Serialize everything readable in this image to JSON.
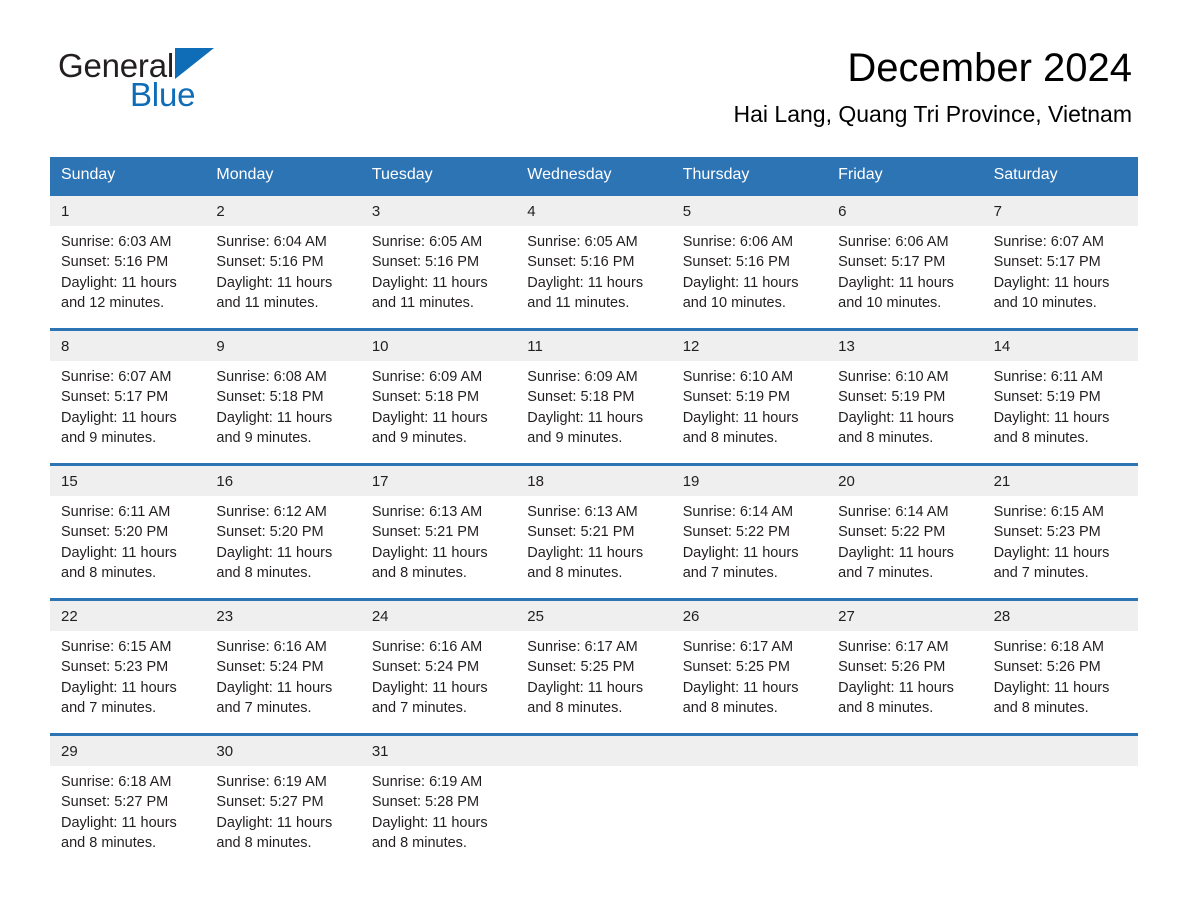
{
  "brand": {
    "name_part1": "General",
    "name_part2": "Blue",
    "accent_color": "#0f6cb6",
    "triangle_icon": "triangle-icon"
  },
  "header": {
    "month_title": "December 2024",
    "location": "Hai Lang, Quang Tri Province, Vietnam"
  },
  "calendar": {
    "header_color": "#2d74b5",
    "day_band_color": "#efefef",
    "weekdays": [
      "Sunday",
      "Monday",
      "Tuesday",
      "Wednesday",
      "Thursday",
      "Friday",
      "Saturday"
    ],
    "weeks": [
      [
        {
          "day": "1",
          "sunrise": "Sunrise: 6:03 AM",
          "sunset": "Sunset: 5:16 PM",
          "daylight_line1": "Daylight: 11 hours",
          "daylight_line2": "and 12 minutes."
        },
        {
          "day": "2",
          "sunrise": "Sunrise: 6:04 AM",
          "sunset": "Sunset: 5:16 PM",
          "daylight_line1": "Daylight: 11 hours",
          "daylight_line2": "and 11 minutes."
        },
        {
          "day": "3",
          "sunrise": "Sunrise: 6:05 AM",
          "sunset": "Sunset: 5:16 PM",
          "daylight_line1": "Daylight: 11 hours",
          "daylight_line2": "and 11 minutes."
        },
        {
          "day": "4",
          "sunrise": "Sunrise: 6:05 AM",
          "sunset": "Sunset: 5:16 PM",
          "daylight_line1": "Daylight: 11 hours",
          "daylight_line2": "and 11 minutes."
        },
        {
          "day": "5",
          "sunrise": "Sunrise: 6:06 AM",
          "sunset": "Sunset: 5:16 PM",
          "daylight_line1": "Daylight: 11 hours",
          "daylight_line2": "and 10 minutes."
        },
        {
          "day": "6",
          "sunrise": "Sunrise: 6:06 AM",
          "sunset": "Sunset: 5:17 PM",
          "daylight_line1": "Daylight: 11 hours",
          "daylight_line2": "and 10 minutes."
        },
        {
          "day": "7",
          "sunrise": "Sunrise: 6:07 AM",
          "sunset": "Sunset: 5:17 PM",
          "daylight_line1": "Daylight: 11 hours",
          "daylight_line2": "and 10 minutes."
        }
      ],
      [
        {
          "day": "8",
          "sunrise": "Sunrise: 6:07 AM",
          "sunset": "Sunset: 5:17 PM",
          "daylight_line1": "Daylight: 11 hours",
          "daylight_line2": "and 9 minutes."
        },
        {
          "day": "9",
          "sunrise": "Sunrise: 6:08 AM",
          "sunset": "Sunset: 5:18 PM",
          "daylight_line1": "Daylight: 11 hours",
          "daylight_line2": "and 9 minutes."
        },
        {
          "day": "10",
          "sunrise": "Sunrise: 6:09 AM",
          "sunset": "Sunset: 5:18 PM",
          "daylight_line1": "Daylight: 11 hours",
          "daylight_line2": "and 9 minutes."
        },
        {
          "day": "11",
          "sunrise": "Sunrise: 6:09 AM",
          "sunset": "Sunset: 5:18 PM",
          "daylight_line1": "Daylight: 11 hours",
          "daylight_line2": "and 9 minutes."
        },
        {
          "day": "12",
          "sunrise": "Sunrise: 6:10 AM",
          "sunset": "Sunset: 5:19 PM",
          "daylight_line1": "Daylight: 11 hours",
          "daylight_line2": "and 8 minutes."
        },
        {
          "day": "13",
          "sunrise": "Sunrise: 6:10 AM",
          "sunset": "Sunset: 5:19 PM",
          "daylight_line1": "Daylight: 11 hours",
          "daylight_line2": "and 8 minutes."
        },
        {
          "day": "14",
          "sunrise": "Sunrise: 6:11 AM",
          "sunset": "Sunset: 5:19 PM",
          "daylight_line1": "Daylight: 11 hours",
          "daylight_line2": "and 8 minutes."
        }
      ],
      [
        {
          "day": "15",
          "sunrise": "Sunrise: 6:11 AM",
          "sunset": "Sunset: 5:20 PM",
          "daylight_line1": "Daylight: 11 hours",
          "daylight_line2": "and 8 minutes."
        },
        {
          "day": "16",
          "sunrise": "Sunrise: 6:12 AM",
          "sunset": "Sunset: 5:20 PM",
          "daylight_line1": "Daylight: 11 hours",
          "daylight_line2": "and 8 minutes."
        },
        {
          "day": "17",
          "sunrise": "Sunrise: 6:13 AM",
          "sunset": "Sunset: 5:21 PM",
          "daylight_line1": "Daylight: 11 hours",
          "daylight_line2": "and 8 minutes."
        },
        {
          "day": "18",
          "sunrise": "Sunrise: 6:13 AM",
          "sunset": "Sunset: 5:21 PM",
          "daylight_line1": "Daylight: 11 hours",
          "daylight_line2": "and 8 minutes."
        },
        {
          "day": "19",
          "sunrise": "Sunrise: 6:14 AM",
          "sunset": "Sunset: 5:22 PM",
          "daylight_line1": "Daylight: 11 hours",
          "daylight_line2": "and 7 minutes."
        },
        {
          "day": "20",
          "sunrise": "Sunrise: 6:14 AM",
          "sunset": "Sunset: 5:22 PM",
          "daylight_line1": "Daylight: 11 hours",
          "daylight_line2": "and 7 minutes."
        },
        {
          "day": "21",
          "sunrise": "Sunrise: 6:15 AM",
          "sunset": "Sunset: 5:23 PM",
          "daylight_line1": "Daylight: 11 hours",
          "daylight_line2": "and 7 minutes."
        }
      ],
      [
        {
          "day": "22",
          "sunrise": "Sunrise: 6:15 AM",
          "sunset": "Sunset: 5:23 PM",
          "daylight_line1": "Daylight: 11 hours",
          "daylight_line2": "and 7 minutes."
        },
        {
          "day": "23",
          "sunrise": "Sunrise: 6:16 AM",
          "sunset": "Sunset: 5:24 PM",
          "daylight_line1": "Daylight: 11 hours",
          "daylight_line2": "and 7 minutes."
        },
        {
          "day": "24",
          "sunrise": "Sunrise: 6:16 AM",
          "sunset": "Sunset: 5:24 PM",
          "daylight_line1": "Daylight: 11 hours",
          "daylight_line2": "and 7 minutes."
        },
        {
          "day": "25",
          "sunrise": "Sunrise: 6:17 AM",
          "sunset": "Sunset: 5:25 PM",
          "daylight_line1": "Daylight: 11 hours",
          "daylight_line2": "and 8 minutes."
        },
        {
          "day": "26",
          "sunrise": "Sunrise: 6:17 AM",
          "sunset": "Sunset: 5:25 PM",
          "daylight_line1": "Daylight: 11 hours",
          "daylight_line2": "and 8 minutes."
        },
        {
          "day": "27",
          "sunrise": "Sunrise: 6:17 AM",
          "sunset": "Sunset: 5:26 PM",
          "daylight_line1": "Daylight: 11 hours",
          "daylight_line2": "and 8 minutes."
        },
        {
          "day": "28",
          "sunrise": "Sunrise: 6:18 AM",
          "sunset": "Sunset: 5:26 PM",
          "daylight_line1": "Daylight: 11 hours",
          "daylight_line2": "and 8 minutes."
        }
      ],
      [
        {
          "day": "29",
          "sunrise": "Sunrise: 6:18 AM",
          "sunset": "Sunset: 5:27 PM",
          "daylight_line1": "Daylight: 11 hours",
          "daylight_line2": "and 8 minutes."
        },
        {
          "day": "30",
          "sunrise": "Sunrise: 6:19 AM",
          "sunset": "Sunset: 5:27 PM",
          "daylight_line1": "Daylight: 11 hours",
          "daylight_line2": "and 8 minutes."
        },
        {
          "day": "31",
          "sunrise": "Sunrise: 6:19 AM",
          "sunset": "Sunset: 5:28 PM",
          "daylight_line1": "Daylight: 11 hours",
          "daylight_line2": "and 8 minutes."
        },
        {
          "day": "",
          "sunrise": "",
          "sunset": "",
          "daylight_line1": "",
          "daylight_line2": ""
        },
        {
          "day": "",
          "sunrise": "",
          "sunset": "",
          "daylight_line1": "",
          "daylight_line2": ""
        },
        {
          "day": "",
          "sunrise": "",
          "sunset": "",
          "daylight_line1": "",
          "daylight_line2": ""
        },
        {
          "day": "",
          "sunrise": "",
          "sunset": "",
          "daylight_line1": "",
          "daylight_line2": ""
        }
      ]
    ]
  }
}
